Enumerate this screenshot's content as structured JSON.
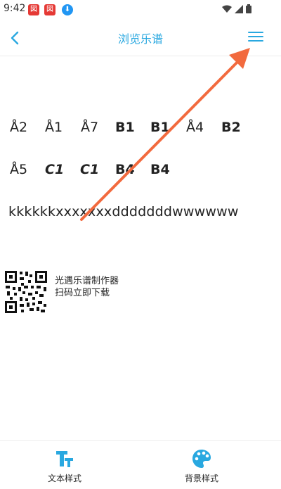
{
  "status_bar": {
    "time": "9:42",
    "notif1": "図",
    "notif2": "図",
    "icons": [
      "wifi-icon",
      "signal-icon",
      "battery-icon"
    ]
  },
  "header": {
    "title": "浏览乐谱",
    "back_icon": "back-chevron-icon",
    "menu_icon": "menu-icon",
    "accent_color": "#29a8e0"
  },
  "sheet": {
    "row1": [
      "Å2",
      "Å1",
      "Å7",
      "B1",
      "B1",
      "Å4",
      "B2"
    ],
    "row2": [
      "Å5",
      "C1",
      "C1",
      "B4",
      "B4"
    ],
    "lyric": "kkkkkkxxxxxxxdddddddwwwwww"
  },
  "promo": {
    "line1": "光遇乐谱制作器",
    "line2": "扫码立即下载"
  },
  "bottom_nav": {
    "items": [
      {
        "label": "文本样式",
        "icon": "text-style-icon"
      },
      {
        "label": "背景样式",
        "icon": "palette-icon"
      }
    ]
  },
  "annotation": {
    "color": "#f26a3e",
    "type": "arrow"
  }
}
